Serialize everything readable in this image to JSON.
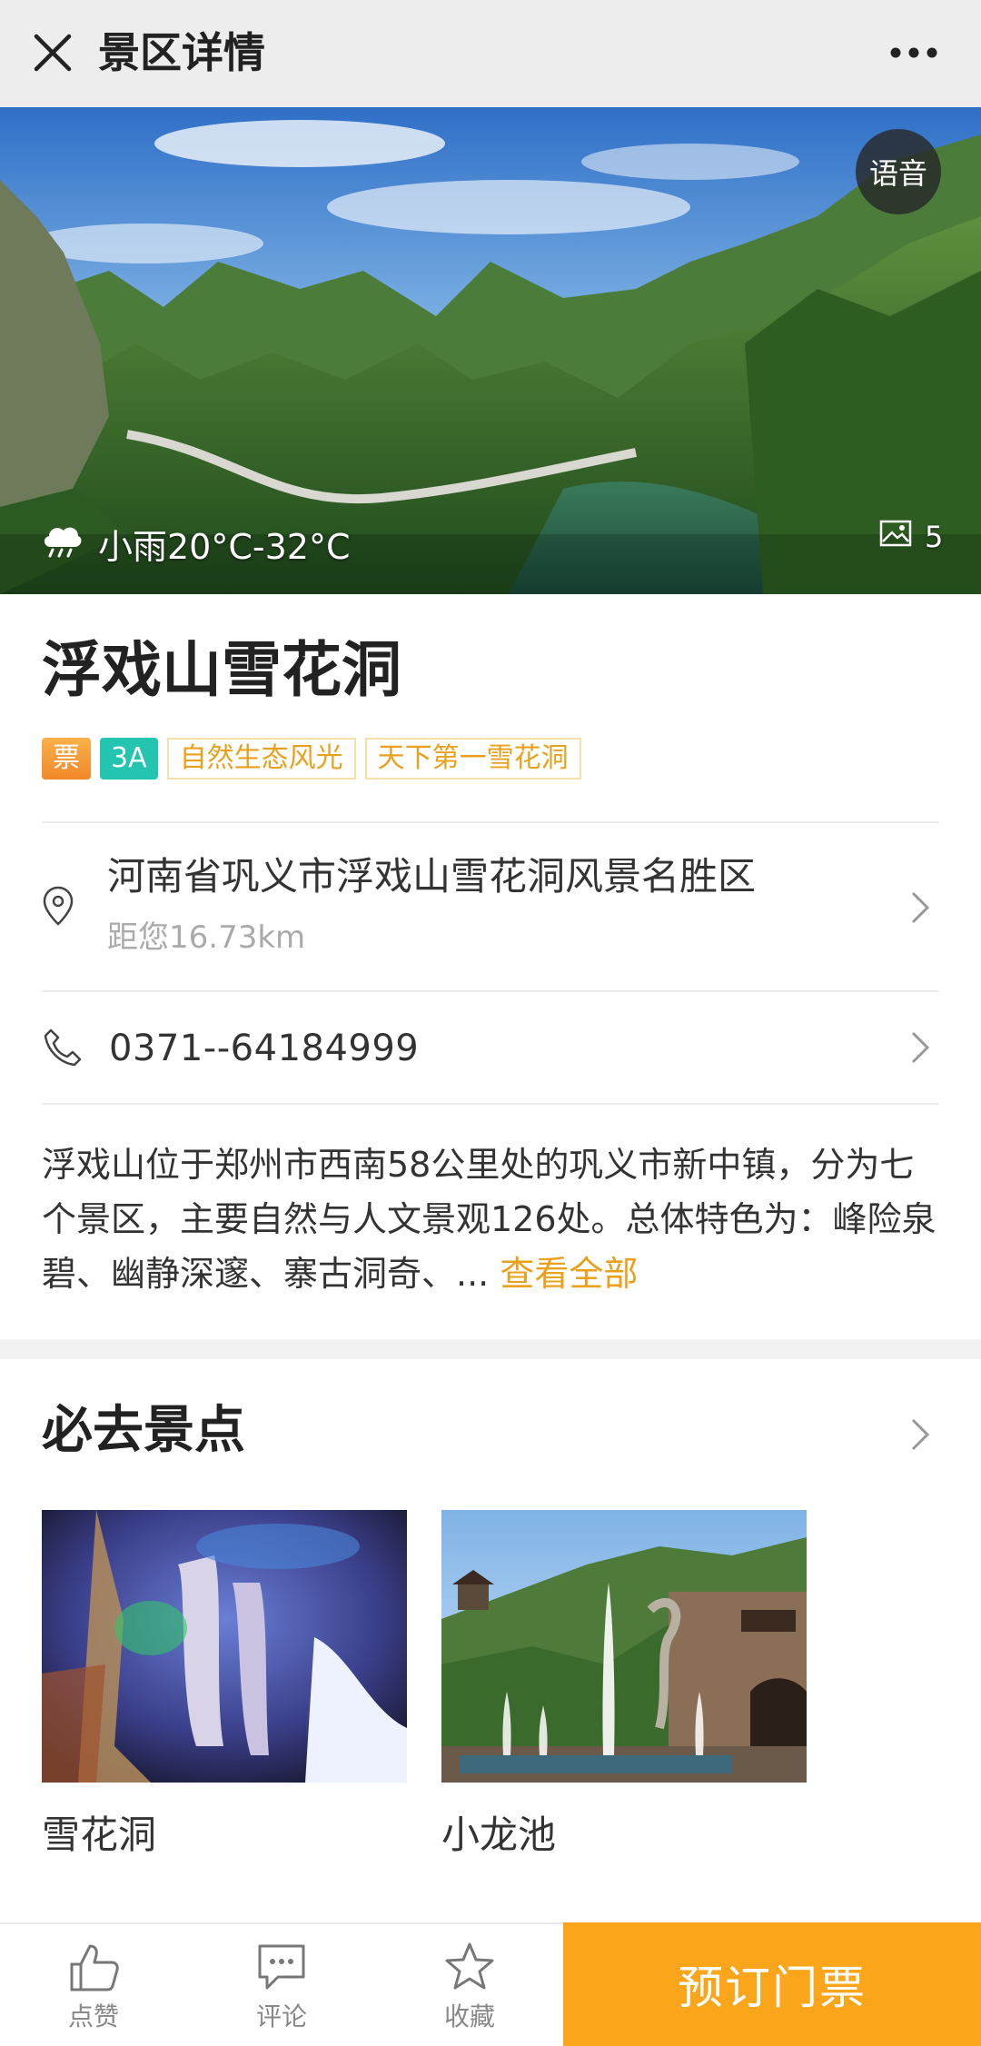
{
  "header": {
    "title": "景区详情",
    "close_icon": "close-icon",
    "more_icon": "more-dots-icon"
  },
  "hero": {
    "voice_label": "语音",
    "weather_icon": "rain-cloud-icon",
    "weather_text": "小雨20°C-32°C",
    "photo_icon": "image-icon",
    "photo_count": "5"
  },
  "scenic": {
    "name": "浮戏山雪花洞",
    "tags": [
      "票",
      "3A",
      "自然生态风光",
      "天下第一雪花洞"
    ],
    "address": "河南省巩义市浮戏山雪花洞风景名胜区",
    "distance": "距您16.73km",
    "phone": "0371--64184999",
    "description": "浮戏山位于郑州市西南58公里处的巩义市新中镇，分为七个景区，主要自然与人文景观126处。总体特色为：峰险泉碧、幽静深邃、寨古洞奇、... ",
    "view_all": "查看全部"
  },
  "must_visit": {
    "title": "必去景点",
    "spots": [
      {
        "name": "雪花洞"
      },
      {
        "name": "小龙池"
      }
    ]
  },
  "bottom_bar": {
    "like": "点赞",
    "comment": "评论",
    "favorite": "收藏",
    "book": "预订门票"
  },
  "colors": {
    "accent": "#fba51a",
    "tag_text": "#e9a11d",
    "tag_teal": "#23c5b1"
  }
}
